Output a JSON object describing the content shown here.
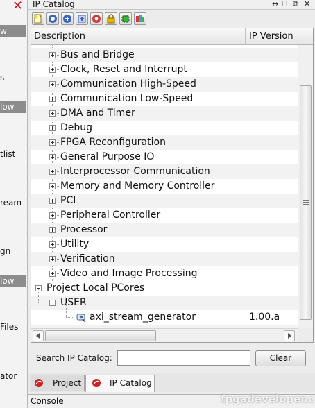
{
  "left_panel": {
    "bars": [
      "w",
      "low",
      "low"
    ],
    "texts": [
      "s",
      "tlist",
      "ream",
      "gn",
      "Files",
      "ator"
    ]
  },
  "window": {
    "title": "IP Catalog",
    "controls": [
      "↔",
      "⎕",
      "⧉",
      "✕"
    ]
  },
  "toolbar": {
    "buttons": [
      "new-icon",
      "info-icon",
      "add-icon",
      "customize-icon",
      "remove-icon",
      "lock-icon",
      "chip-icon",
      "package-icon"
    ]
  },
  "table": {
    "col_description": "Description",
    "col_version": "IP Version",
    "categories": [
      "Bus and Bridge",
      "Clock, Reset and Interrupt",
      "Communication High-Speed",
      "Communication Low-Speed",
      "DMA and Timer",
      "Debug",
      "FPGA Reconfiguration",
      "General Purpose IO",
      "Interprocessor Communication",
      "Memory and Memory Controller",
      "PCI",
      "Peripheral Controller",
      "Processor",
      "Utility",
      "Verification",
      "Video and Image Processing"
    ],
    "local_group": "Project Local PCores",
    "user_group": "USER",
    "user_item": {
      "name": "axi_stream_generator",
      "version": "1.00.a"
    }
  },
  "search": {
    "label": "Search IP Catalog:",
    "value": "",
    "clear_label": "Clear"
  },
  "tabs": {
    "project": "Project",
    "ip_catalog": "IP Catalog"
  },
  "console": {
    "label": "Console"
  },
  "watermark": "fpgadeveloper.c"
}
